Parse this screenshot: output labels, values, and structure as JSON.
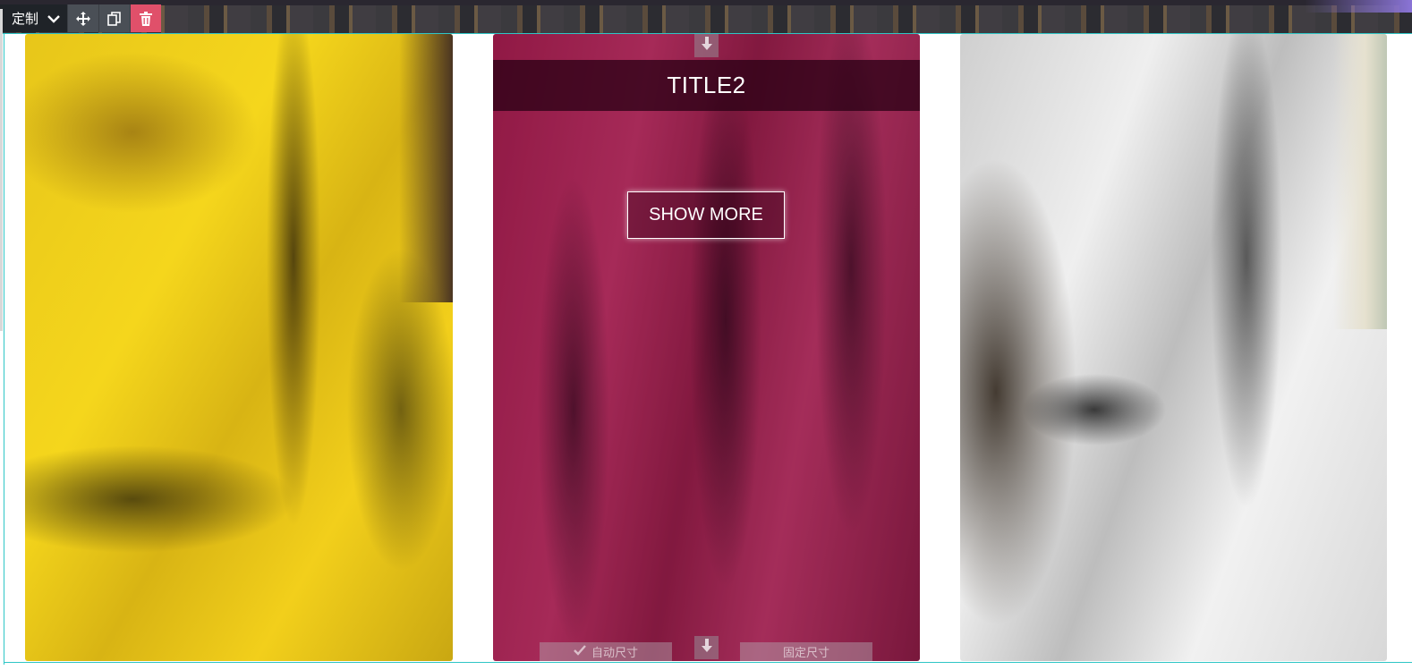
{
  "toolbar": {
    "select_label": "定制",
    "buttons": [
      "move-icon",
      "copy-icon",
      "trash-icon"
    ]
  },
  "cards": [
    {
      "name": "yellow-fur-card"
    },
    {
      "name": "pink-fur-card",
      "title": "TITLE2",
      "button_label": "SHOW MORE",
      "auto_size_label": "自动尺寸",
      "fixed_size_label": "固定尺寸"
    },
    {
      "name": "white-fur-card"
    }
  ],
  "colors": {
    "frame_accent": "#2fc6c6",
    "delete_button": "#e0506a",
    "toolbar_dark": "#1f2328"
  }
}
